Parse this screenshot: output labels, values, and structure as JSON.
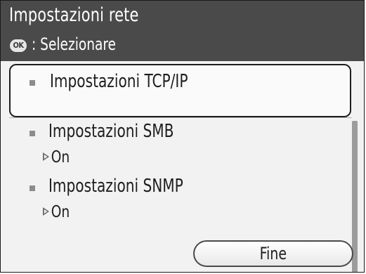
{
  "header": {
    "title": "Impostazioni rete",
    "ok_icon_label": "OK",
    "instruction": ": Selezionare"
  },
  "list": {
    "items": [
      {
        "label": "Impostazioni TCP/IP",
        "value": "",
        "selected": true
      },
      {
        "label": "Impostazioni SMB",
        "value": "On",
        "selected": false
      },
      {
        "label": "Impostazioni SNMP",
        "value": "On",
        "selected": false
      }
    ]
  },
  "footer": {
    "done_label": "Fine"
  },
  "colors": {
    "header_bg": "#4a4a4a",
    "list_bg": "#f2f2f2",
    "bullet": "#8c8c8c",
    "border": "#1e1e1e"
  },
  "icons": [
    "ok-button-icon",
    "bullet-square-icon",
    "value-arrow-icon"
  ]
}
